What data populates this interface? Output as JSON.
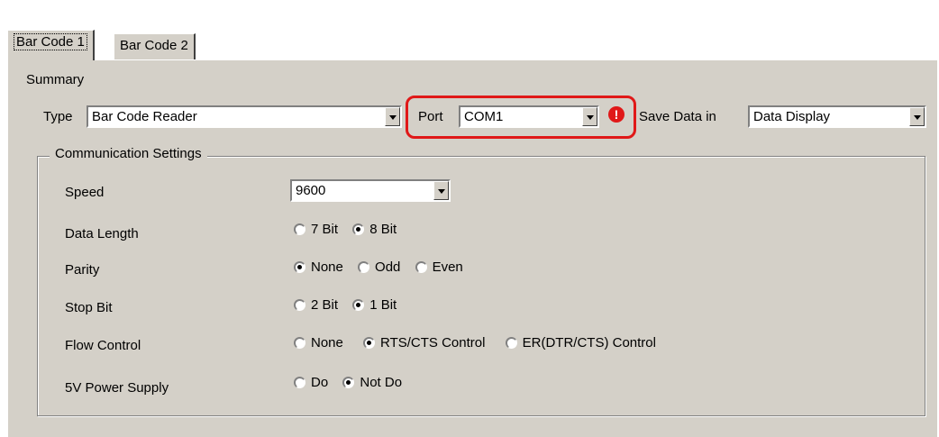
{
  "tabs": [
    {
      "label": "Bar Code 1"
    },
    {
      "label": "Bar Code 2"
    }
  ],
  "summary": {
    "title": "Summary",
    "type_label": "Type",
    "type_value": "Bar Code Reader",
    "port_label": "Port",
    "port_value": "COM1",
    "save_label": "Save Data in",
    "save_value": "Data Display"
  },
  "warning_icon": {
    "name": "exclamation-icon",
    "glyph": "!",
    "color": "#e01818"
  },
  "highlight_color": "#e01818",
  "comm": {
    "title": "Communication Settings",
    "speed": {
      "label": "Speed",
      "value": "9600"
    },
    "data_length": {
      "label": "Data Length",
      "options": [
        "7 Bit",
        "8 Bit"
      ],
      "selected": "8 Bit"
    },
    "parity": {
      "label": "Parity",
      "options": [
        "None",
        "Odd",
        "Even"
      ],
      "selected": "None"
    },
    "stop_bit": {
      "label": "Stop Bit",
      "options": [
        "2 Bit",
        "1 Bit"
      ],
      "selected": "1 Bit"
    },
    "flow_control": {
      "label": "Flow Control",
      "options": [
        "None",
        "RTS/CTS Control",
        "ER(DTR/CTS) Control"
      ],
      "selected": "RTS/CTS Control"
    },
    "power": {
      "label": "5V Power Supply",
      "options": [
        "Do",
        "Not Do"
      ],
      "selected": "Not Do"
    }
  }
}
